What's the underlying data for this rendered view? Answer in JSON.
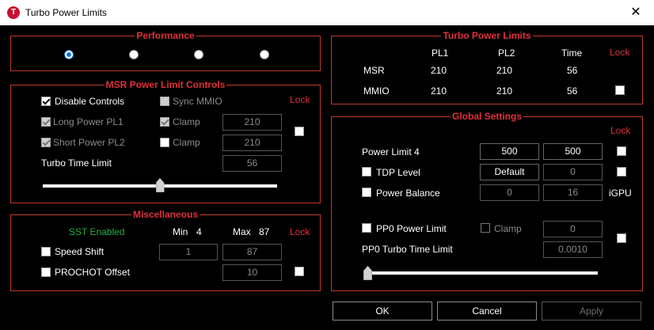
{
  "window": {
    "title": "Turbo Power Limits",
    "app_icon_letter": "T",
    "close_glyph": "✕"
  },
  "performance": {
    "title": "Performance",
    "radios": [
      true,
      false,
      false,
      false
    ]
  },
  "msr": {
    "title": "MSR Power Limit Controls",
    "disable_controls": "Disable Controls",
    "sync_mmio": "Sync MMIO",
    "lock": "Lock",
    "long_power": "Long Power PL1",
    "short_power": "Short Power PL2",
    "clamp1": "Clamp",
    "clamp2": "Clamp",
    "pl1_value": "210",
    "pl2_value": "210",
    "turbo_time_label": "Turbo Time Limit",
    "turbo_time_value": "56",
    "slider_fraction": 0.5
  },
  "misc": {
    "title": "Miscellaneous",
    "sst": "SST Enabled",
    "min_label": "Min",
    "min_value": "4",
    "max_label": "Max",
    "max_value": "87",
    "lock": "Lock",
    "speed_shift": "Speed Shift",
    "speed_min": "1",
    "speed_max": "87",
    "prochot": "PROCHOT Offset",
    "prochot_value": "10"
  },
  "turbo": {
    "title": "Turbo Power Limits",
    "col_pl1": "PL1",
    "col_pl2": "PL2",
    "col_time": "Time",
    "lock": "Lock",
    "rows": [
      {
        "label": "MSR",
        "pl1": "210",
        "pl2": "210",
        "time": "56"
      },
      {
        "label": "MMIO",
        "pl1": "210",
        "pl2": "210",
        "time": "56"
      }
    ]
  },
  "global": {
    "title": "Global Settings",
    "lock": "Lock",
    "power_limit4": "Power Limit 4",
    "pl4_a": "500",
    "pl4_b": "500",
    "tdp_level": "TDP Level",
    "tdp_value": "Default",
    "tdp_num": "0",
    "power_balance": "Power Balance",
    "pb_a": "0",
    "pb_b": "16",
    "igpu": "iGPU",
    "pp0_limit": "PP0 Power Limit",
    "pp0_clamp": "Clamp",
    "pp0_value": "0",
    "pp0_time_label": "PP0 Turbo Time Limit",
    "pp0_time_value": "0.0010",
    "slider_fraction": 0.0
  },
  "buttons": {
    "ok": "OK",
    "cancel": "Cancel",
    "apply": "Apply"
  }
}
